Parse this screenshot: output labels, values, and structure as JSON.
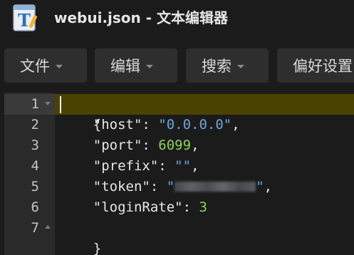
{
  "window": {
    "title": "webui.json - 文本编辑器",
    "app_icon": "text-editor-icon"
  },
  "menubar": {
    "items": [
      {
        "label": "文件",
        "icon": "chevron-down-icon"
      },
      {
        "label": "编辑",
        "icon": "chevron-down-icon"
      },
      {
        "label": "搜索",
        "icon": "chevron-down-icon"
      },
      {
        "label": "偏好设置"
      }
    ]
  },
  "editor": {
    "current_line": 1,
    "lines": [
      {
        "num": "1",
        "open": "{"
      },
      {
        "num": "2",
        "key": "\"host\"",
        "sep": ": ",
        "value": "\"0.0.0.0\"",
        "end": ","
      },
      {
        "num": "3",
        "key": "\"port\"",
        "sep": ": ",
        "value": "6099",
        "end": ","
      },
      {
        "num": "4",
        "key": "\"prefix\"",
        "sep": ": ",
        "value": "\"\"",
        "end": ","
      },
      {
        "num": "5",
        "key": "\"token\"",
        "sep": ": ",
        "value_open": "\"",
        "value_close": "\"",
        "end": ","
      },
      {
        "num": "6",
        "key": "\"loginRate\"",
        "sep": ": ",
        "value": "3"
      },
      {
        "num": "7",
        "close": "}"
      }
    ]
  },
  "colors": {
    "background": "#1b1b1b",
    "gutter": "#2a2a2a",
    "current_line_highlight": "#4a4200",
    "string": "#6fa6dc",
    "number": "#8bd35a",
    "text": "#e6e6e6"
  }
}
